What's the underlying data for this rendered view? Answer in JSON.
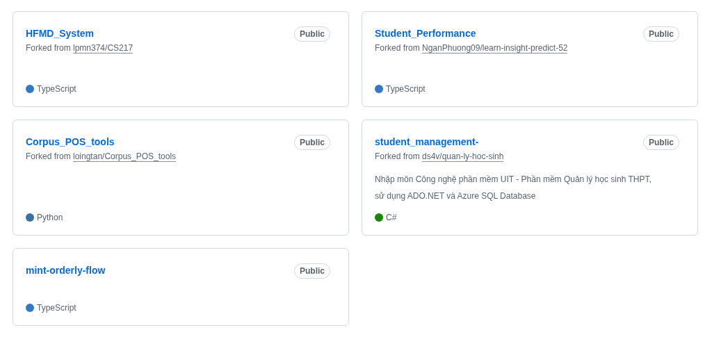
{
  "repositories": [
    {
      "name": "HFMD_System",
      "visibility": "Public",
      "forked_from_label": "Forked from",
      "forked_from": "lpmn374/CS217",
      "language": "TypeScript",
      "color": "#3178c6"
    },
    {
      "name": "Student_Performance",
      "visibility": "Public",
      "forked_from_label": "Forked from",
      "forked_from": "NganPhuong09/learn-insight-predict-52",
      "language": "TypeScript",
      "color": "#3178c6"
    },
    {
      "name": "Corpus_POS_tools",
      "visibility": "Public",
      "forked_from_label": "Forked from",
      "forked_from": "loingtan/Corpus_POS_tools",
      "language": "Python",
      "color": "#3572a5"
    },
    {
      "name": "student_management-",
      "visibility": "Public",
      "forked_from_label": "Forked from",
      "forked_from": "ds4v/quan-ly-hoc-sinh",
      "description": "Nhập môn Công nghệ phần mềm UIT - Phần mềm Quản lý học sinh THPT, sử dụng ADO.NET và Azure SQL Database",
      "language": "C#",
      "color": "#178600"
    },
    {
      "name": "mint-orderly-flow",
      "visibility": "Public",
      "language": "TypeScript",
      "color": "#3178c6"
    }
  ]
}
